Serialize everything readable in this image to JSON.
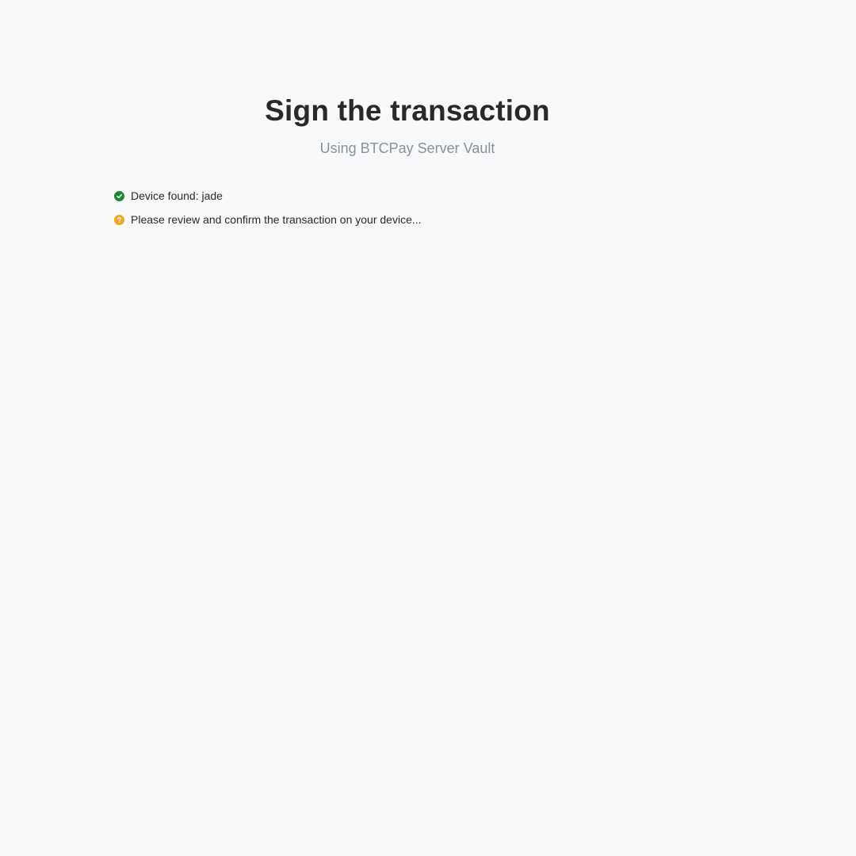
{
  "header": {
    "title": "Sign the transaction",
    "subtitle": "Using BTCPay Server Vault"
  },
  "status": {
    "items": [
      {
        "icon": "check-circle-icon",
        "color": "#1a8731",
        "text": "Device found: jade"
      },
      {
        "icon": "question-circle-icon",
        "color": "#f4a41d",
        "text": "Please review and confirm the transaction on your device..."
      }
    ]
  }
}
